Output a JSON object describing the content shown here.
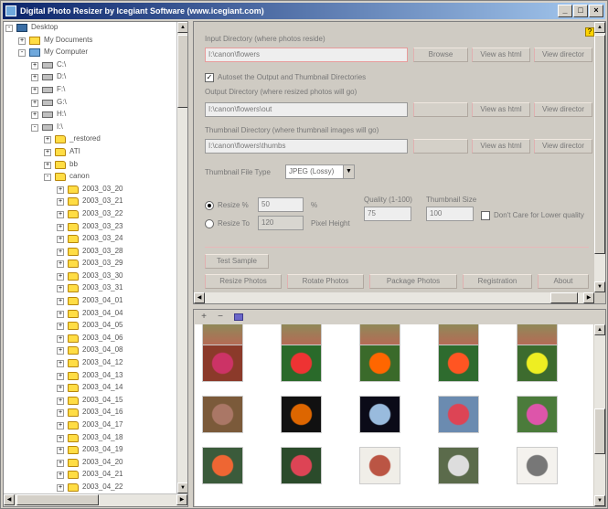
{
  "window": {
    "title": "Digital Photo Resizer by Icegiant Software (www.icegiant.com)",
    "controls": [
      "_",
      "□",
      "×"
    ]
  },
  "tree": {
    "items": [
      {
        "label": "Desktop",
        "indent": 0,
        "icon": "desktop-icon",
        "expander": "-"
      },
      {
        "label": "My Documents",
        "indent": 1,
        "icon": "documents-icon",
        "expander": "+"
      },
      {
        "label": "My Computer",
        "indent": 1,
        "icon": "computer-icon",
        "expander": "-"
      },
      {
        "label": "C:\\",
        "indent": 2,
        "icon": "drive-icon",
        "expander": "+"
      },
      {
        "label": "D:\\",
        "indent": 2,
        "icon": "drive-icon",
        "expander": "+"
      },
      {
        "label": "F:\\",
        "indent": 2,
        "icon": "drive-icon",
        "expander": "+"
      },
      {
        "label": "G:\\",
        "indent": 2,
        "icon": "drive-icon",
        "expander": "+"
      },
      {
        "label": "H:\\",
        "indent": 2,
        "icon": "drive-icon",
        "expander": "+"
      },
      {
        "label": "I:\\",
        "indent": 2,
        "icon": "drive-icon",
        "expander": "-"
      },
      {
        "label": "_restored",
        "indent": 3,
        "icon": "folder-icon",
        "expander": "+"
      },
      {
        "label": "ATI",
        "indent": 3,
        "icon": "folder-icon",
        "expander": "+"
      },
      {
        "label": "bb",
        "indent": 3,
        "icon": "folder-icon",
        "expander": "+"
      },
      {
        "label": "canon",
        "indent": 3,
        "icon": "folder-icon",
        "expander": "-"
      },
      {
        "label": "2003_03_20",
        "indent": 4,
        "icon": "folder-icon",
        "expander": "+"
      },
      {
        "label": "2003_03_21",
        "indent": 4,
        "icon": "folder-icon",
        "expander": "+"
      },
      {
        "label": "2003_03_22",
        "indent": 4,
        "icon": "folder-icon",
        "expander": "+"
      },
      {
        "label": "2003_03_23",
        "indent": 4,
        "icon": "folder-icon",
        "expander": "+"
      },
      {
        "label": "2003_03_24",
        "indent": 4,
        "icon": "folder-icon",
        "expander": "+"
      },
      {
        "label": "2003_03_28",
        "indent": 4,
        "icon": "folder-icon",
        "expander": "+"
      },
      {
        "label": "2003_03_29",
        "indent": 4,
        "icon": "folder-icon",
        "expander": "+"
      },
      {
        "label": "2003_03_30",
        "indent": 4,
        "icon": "folder-icon",
        "expander": "+"
      },
      {
        "label": "2003_03_31",
        "indent": 4,
        "icon": "folder-icon",
        "expander": "+"
      },
      {
        "label": "2003_04_01",
        "indent": 4,
        "icon": "folder-icon",
        "expander": "+"
      },
      {
        "label": "2003_04_04",
        "indent": 4,
        "icon": "folder-icon",
        "expander": "+"
      },
      {
        "label": "2003_04_05",
        "indent": 4,
        "icon": "folder-icon",
        "expander": "+"
      },
      {
        "label": "2003_04_06",
        "indent": 4,
        "icon": "folder-icon",
        "expander": "+"
      },
      {
        "label": "2003_04_08",
        "indent": 4,
        "icon": "folder-icon",
        "expander": "+"
      },
      {
        "label": "2003_04_12",
        "indent": 4,
        "icon": "folder-icon",
        "expander": "+"
      },
      {
        "label": "2003_04_13",
        "indent": 4,
        "icon": "folder-icon",
        "expander": "+"
      },
      {
        "label": "2003_04_14",
        "indent": 4,
        "icon": "folder-icon",
        "expander": "+"
      },
      {
        "label": "2003_04_15",
        "indent": 4,
        "icon": "folder-icon",
        "expander": "+"
      },
      {
        "label": "2003_04_16",
        "indent": 4,
        "icon": "folder-icon",
        "expander": "+"
      },
      {
        "label": "2003_04_17",
        "indent": 4,
        "icon": "folder-icon",
        "expander": "+"
      },
      {
        "label": "2003_04_18",
        "indent": 4,
        "icon": "folder-icon",
        "expander": "+"
      },
      {
        "label": "2003_04_19",
        "indent": 4,
        "icon": "folder-icon",
        "expander": "+"
      },
      {
        "label": "2003_04_20",
        "indent": 4,
        "icon": "folder-icon",
        "expander": "+"
      },
      {
        "label": "2003_04_21",
        "indent": 4,
        "icon": "folder-icon",
        "expander": "+"
      },
      {
        "label": "2003_04_22",
        "indent": 4,
        "icon": "folder-icon",
        "expander": "+"
      }
    ]
  },
  "settings": {
    "input_dir_label": "Input Directory (where photos reside)",
    "input_dir_value": "I:\\canon\\flowers",
    "browse_label": "Browse",
    "view_in_html_label": "View as html",
    "view_dir_label": "View director",
    "auto_set_label": "Autoset the Output and Thumbnail Directories",
    "output_dir_label": "Output Directory (where resized photos will go)",
    "output_dir_value": "I:\\canon\\flowers\\out",
    "thumb_dir_label": "Thumbnail Directory (where thumbnail images will go)",
    "thumb_dir_value": "I:\\canon\\flowers\\thumbs",
    "file_type_label": "Thumbnail File Type",
    "file_type_value": "JPEG (Lossy)",
    "resize_pct_label": "Resize %",
    "resize_pct_value": "50",
    "pct_unit": "%",
    "resize_px_label": "Resize To",
    "resize_px_value": "120",
    "pixel_height_label": "Pixel Height",
    "quality_label": "Quality (1-100)",
    "quality_value": "75",
    "thumb_size_label": "Thumbnail Size",
    "thumb_size_value": "100",
    "lower_quality_label": "Don't Care for Lower quality",
    "test_sample_label": "Test Sample",
    "buttons": {
      "resize": "Resize Photos",
      "rotate": "Rotate Photos",
      "package": "Package Photos",
      "registration": "Registration",
      "about": "About"
    },
    "help_icon": "?"
  },
  "thumbs_toolbar": {
    "zoom_in": "+",
    "zoom_out": "−"
  },
  "thumbnails": [
    {
      "name": "photo-1",
      "colors": [
        "#8b3a2a",
        "#c36"
      ]
    },
    {
      "name": "photo-2",
      "colors": [
        "#2a6a2a",
        "#e33"
      ]
    },
    {
      "name": "photo-3",
      "colors": [
        "#3a6a2a",
        "#f60"
      ]
    },
    {
      "name": "photo-4",
      "colors": [
        "#2e6b2e",
        "#f52"
      ]
    },
    {
      "name": "photo-5",
      "colors": [
        "#3d6b2e",
        "#ee2"
      ]
    },
    {
      "name": "photo-6",
      "colors": [
        "#7b5a3a",
        "#a76"
      ]
    },
    {
      "name": "photo-7",
      "colors": [
        "#111",
        "#d60"
      ]
    },
    {
      "name": "photo-8",
      "colors": [
        "#0b0b18",
        "#9bd"
      ]
    },
    {
      "name": "photo-9",
      "colors": [
        "#6b8bb0",
        "#d45"
      ]
    },
    {
      "name": "photo-10",
      "colors": [
        "#4b7b3b",
        "#d5a"
      ]
    },
    {
      "name": "photo-11",
      "colors": [
        "#3b5b3b",
        "#e63"
      ]
    },
    {
      "name": "photo-12",
      "colors": [
        "#2b4b2b",
        "#d45"
      ]
    },
    {
      "name": "photo-13",
      "colors": [
        "#f0eee8",
        "#b54"
      ]
    },
    {
      "name": "photo-14",
      "colors": [
        "#5b6b4b",
        "#ddd"
      ]
    },
    {
      "name": "photo-15",
      "colors": [
        "#f4f2ee",
        "#777"
      ]
    }
  ]
}
